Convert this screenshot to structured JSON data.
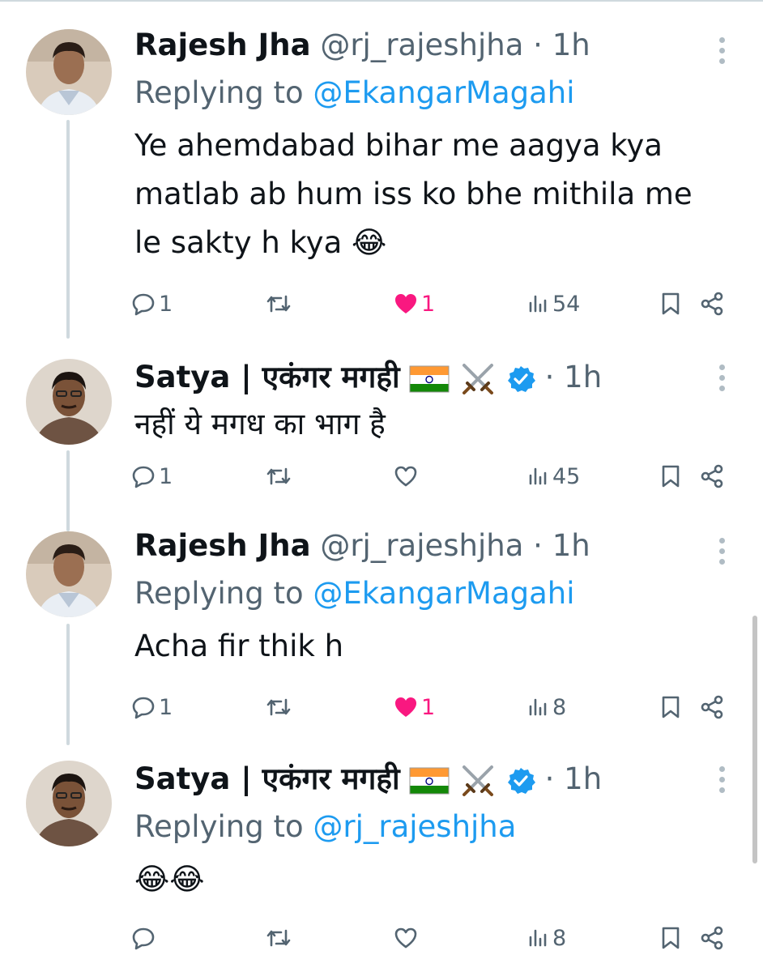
{
  "tweets": [
    {
      "author": "Rajesh Jha",
      "handle": "@rj_rajeshjha",
      "sep": "·",
      "time": "1h",
      "replying_prefix": "Replying to",
      "replying_to": "@EkangarMagahi",
      "text": "Ye ahemdabad bihar me aagya kya matlab ab hum iss ko bhe mithila me le sakty h kya 😂",
      "replies": "1",
      "likes": "1",
      "liked": true,
      "views": "54"
    },
    {
      "author": "Satya | एकंगर मगही",
      "verified": true,
      "badges": [
        "india-flag",
        "crossed-swords"
      ],
      "sep": "·",
      "time": "1h",
      "text": "नहीं ये मगध का भाग है",
      "replies": "1",
      "liked": false,
      "views": "45"
    },
    {
      "author": "Rajesh Jha",
      "handle": "@rj_rajeshjha",
      "sep": "·",
      "time": "1h",
      "replying_prefix": "Replying to",
      "replying_to": "@EkangarMagahi",
      "text": "Acha fir thik h",
      "replies": "1",
      "likes": "1",
      "liked": true,
      "views": "8"
    },
    {
      "author": "Satya | एकंगर मगही",
      "verified": true,
      "badges": [
        "india-flag",
        "crossed-swords"
      ],
      "sep": "·",
      "time": "1h",
      "replying_prefix": "Replying to",
      "replying_to": "@rj_rajeshjha",
      "text": "😂😂",
      "liked": false,
      "views": "8"
    }
  ],
  "colors": {
    "link": "#1d9bf0",
    "secondary": "#536471",
    "like": "#f91880",
    "thread_line": "#cfd9de"
  },
  "icons": [
    "reply-icon",
    "retweet-icon",
    "like-icon",
    "views-icon",
    "bookmark-icon",
    "share-icon",
    "more-icon",
    "verified-icon"
  ]
}
